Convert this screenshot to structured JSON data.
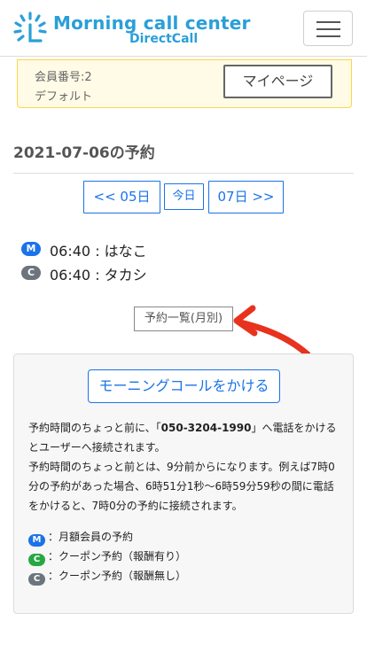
{
  "header": {
    "brand_title": "Morning call center",
    "brand_subtitle": "DirectCall",
    "logo_icon": "sun-burst-icon",
    "menu_icon": "hamburger-icon",
    "brand_color": "#2a9fd8"
  },
  "member": {
    "number_label": "会員番号:2",
    "plan_label": "デフォルト",
    "mypage_label": "マイページ"
  },
  "schedule": {
    "title": "2021-07-06の予約",
    "prev_label": "<< 05日",
    "today_label": "今日",
    "next_label": "07日 >>"
  },
  "reservations": [
    {
      "badge": "M",
      "text": "06:40 : はなこ",
      "badge_color": "#1a73e8"
    },
    {
      "badge": "C",
      "text": "06:40 : タカシ",
      "badge_color": "#6c757d"
    }
  ],
  "monthly_list_label": "予約一覧(月別)",
  "annotation_arrow_color": "#e8321e",
  "info": {
    "call_button_label": "モーニングコールをかける",
    "para1_before": "予約時間のちょっと前に、「",
    "phone": "050-3204-1990",
    "para1_after": "」へ電話をかけるとユーザーへ接続されます。",
    "para2": "予約時間のちょっと前とは、9分前からになります。例えば7時0分の予約があった場合、6時51分1秒〜6時59分59秒の間に電話をかけると、7時0分の予約に接続されます。",
    "legend": [
      {
        "badge": "M",
        "text": "：月額会員の予約",
        "color": "#1a73e8"
      },
      {
        "badge": "C",
        "text": "：クーポン予約（報酬有り）",
        "color": "#28a745"
      },
      {
        "badge": "C",
        "text": "：クーポン予約（報酬無し）",
        "color": "#6c757d"
      }
    ]
  }
}
